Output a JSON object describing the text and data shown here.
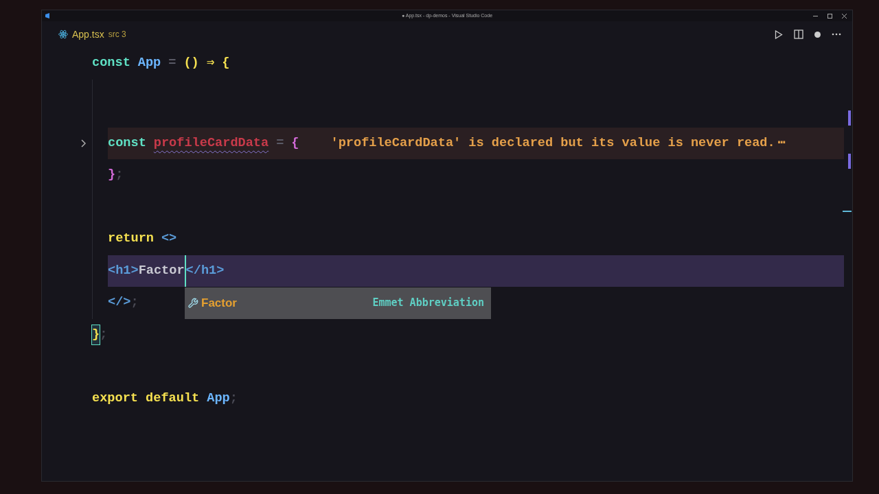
{
  "window": {
    "title": "● App.tsx - dp-demos - Visual Studio Code"
  },
  "tab": {
    "name": "App.tsx",
    "detail": "src 3",
    "selected": true
  },
  "sticky_line": {
    "tokens": [
      {
        "text": "const",
        "kind": "decl"
      },
      {
        "text": "App",
        "kind": "ident"
      },
      {
        "text": "=",
        "kind": "op"
      },
      {
        "text": "() ⇒ {",
        "kind": "paren"
      }
    ]
  },
  "lines": [
    {
      "kind": "block",
      "children": [
        {
          "kind": "blank"
        },
        {
          "kind": "blank"
        },
        {
          "kind": "code",
          "diagnostic": true,
          "folded": true,
          "tokens": [
            {
              "text": "const",
              "kind": "decl"
            },
            {
              "text": "profileCardData",
              "kind": "unused",
              "squiggle": true
            },
            {
              "text": "=",
              "kind": "op"
            },
            {
              "text": "{",
              "kind": "brace"
            }
          ],
          "hint": "'profileCardData' is declared but its value is never read.",
          "hint_more": "⋯"
        },
        {
          "kind": "code",
          "tokens": [
            {
              "text": "}",
              "kind": "brace"
            },
            {
              "text": ";",
              "kind": "punct"
            }
          ]
        },
        {
          "kind": "blank"
        },
        {
          "kind": "code",
          "tokens": [
            {
              "text": "return",
              "kind": "flow"
            },
            {
              "text": "<>",
              "kind": "tag"
            }
          ]
        },
        {
          "kind": "code",
          "current": true,
          "tokens": [
            {
              "text": "<h1>",
              "kind": "tag"
            },
            {
              "text": "Factor",
              "kind": "text",
              "cursor": true
            },
            {
              "text": "</h1>",
              "kind": "tag"
            }
          ],
          "suggest": {
            "label": "Factor",
            "detail": "Emmet Abbreviation"
          }
        },
        {
          "kind": "code",
          "tokens": [
            {
              "text": "</>",
              "kind": "tag"
            },
            {
              "text": ";",
              "kind": "punct"
            }
          ]
        }
      ]
    },
    {
      "kind": "code",
      "tokens": [
        {
          "text": "}",
          "kind": "paren",
          "matched": true
        },
        {
          "text": ";",
          "kind": "punct"
        }
      ]
    },
    {
      "kind": "blank"
    },
    {
      "kind": "code",
      "tokens": [
        {
          "text": "export default",
          "kind": "flow"
        },
        {
          "text": "App",
          "kind": "ident"
        },
        {
          "text": ";",
          "kind": "punct"
        }
      ]
    }
  ]
}
